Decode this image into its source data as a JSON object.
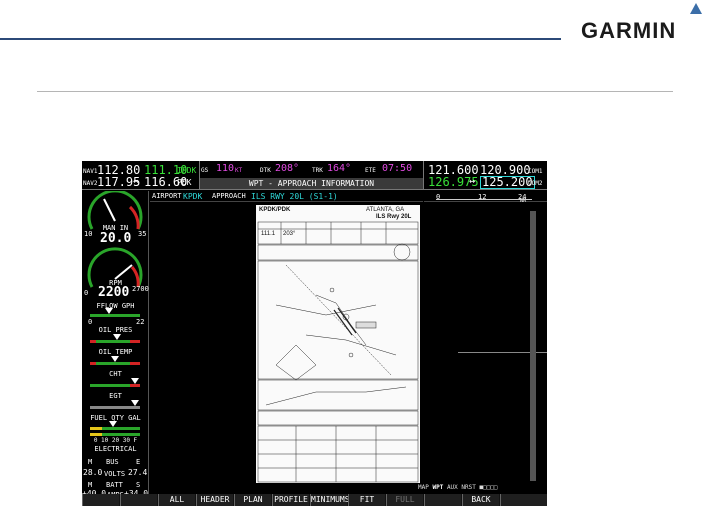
{
  "brand": {
    "name": "GARMIN"
  },
  "nav": {
    "nav1_label": "NAV1",
    "nav1_active": "112.80",
    "nav1_standby": "111.10",
    "nav1_id": "IPDK",
    "nav2_label": "NAV2",
    "nav2_active": "117.95",
    "nav2_swap": "↔",
    "nav2_standby": "116.60",
    "nav2_id": "PDK"
  },
  "data_bar": {
    "gs_label": "GS",
    "gs_value": "110",
    "gs_unit": "KT",
    "dtk_label": "DTK",
    "dtk_value": "208°",
    "trk_label": "TRK",
    "trk_value": "164°",
    "ete_label": "ETE",
    "ete_value": "07:50",
    "page_title": "WPT - APPROACH INFORMATION"
  },
  "com": {
    "com1_active": "121.600",
    "com1_standby": "120.900",
    "com1_label": "COM1",
    "com2_active": "126.975",
    "com2_swap": "↔",
    "com2_standby": "125.200",
    "com2_label": "COM2"
  },
  "approach_row": {
    "airport_label": "AIRPORT",
    "airport": "KPDK",
    "approach_label": "APPROACH",
    "approach": "ILS RWY 20L (S1-1)"
  },
  "range_scale": {
    "t0": "0",
    "t1": "12",
    "t2": "24",
    "unit": "NM"
  },
  "engine": {
    "man_in_label": "MAN IN",
    "man_in_value": "20.0",
    "man_min": "10",
    "man_max": "35",
    "rpm_label": "RPM",
    "rpm_value": "2200",
    "rpm_min": "0",
    "rpm_max": "2700",
    "fflow_label": "FFLOW GPH",
    "fflow_min": "0",
    "fflow_max": "22",
    "oil_pres_label": "OIL PRES",
    "oil_temp_label": "OIL TEMP",
    "cht_label": "CHT",
    "egt_label": "EGT",
    "fuel_label": "FUEL QTY GAL",
    "fuel_ticks": "0  10  20  30  F",
    "electrical_label": "ELECTRICAL",
    "m_label": "M",
    "bus_label": "BUS",
    "e_label": "E",
    "volts_m": "28.0",
    "volts_label": "VOLTS",
    "volts_e": "27.4",
    "batt_m": "M",
    "batt_label": "BATT",
    "batt_s": "S",
    "amps_m": "+40.0",
    "amps_label": "AMPS",
    "amps_s": "+34.0"
  },
  "chart": {
    "airport": "KPDK/PDK",
    "city": "ATLANTA, GA",
    "procedure": "ILS Rwy 20L",
    "freq": "111.1",
    "course": "203°"
  },
  "page_group": {
    "map": "MAP",
    "wpt": "WPT",
    "aux": "AUX",
    "nrst": "NRST"
  },
  "softkeys": {
    "all": "ALL",
    "header": "HEADER",
    "plan": "PLAN",
    "profile": "PROFILE",
    "minimums": "MINIMUMS",
    "fit_wdth": "FIT WDTH",
    "full_scn": "FULL SCN",
    "back": "BACK"
  },
  "colors": {
    "cyan": "#2fd9d9",
    "magenta": "#e24be2",
    "green": "#38e038"
  }
}
